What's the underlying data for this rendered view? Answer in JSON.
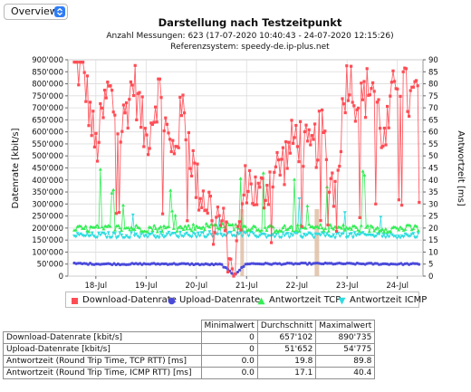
{
  "toolbar": {
    "view_select": "Overview"
  },
  "chart": {
    "title": "Darstellung nach Testzeitpunkt",
    "subtitle1": "Anzahl Messungen: 623 (17-07-2020 10:40:43 - 24-07-2020 12:15:26)",
    "subtitle2": "Referenzsystem: speedy-de.ip-plus.net",
    "ylabel_left": "Datenrate [kbit/s]",
    "ylabel_right": "Antwortzeit [ms]",
    "y_left_ticks": [
      "0",
      "50'000",
      "100'000",
      "150'000",
      "200'000",
      "250'000",
      "300'000",
      "350'000",
      "400'000",
      "450'000",
      "500'000",
      "550'000",
      "600'000",
      "650'000",
      "700'000",
      "750'000",
      "800'000",
      "850'000",
      "900'000"
    ],
    "y_right_ticks": [
      "0",
      "5",
      "10",
      "15",
      "20",
      "25",
      "30",
      "35",
      "40",
      "45",
      "50",
      "55",
      "60",
      "65",
      "70",
      "75",
      "80",
      "85",
      "90"
    ],
    "x_ticks": [
      "18-Jul",
      "19-Jul",
      "20-Jul",
      "21-Jul",
      "22-Jul",
      "23-Jul",
      "24-Jul"
    ],
    "colors": {
      "download": "#ff4d55",
      "upload": "#4b4bdb",
      "tcp": "#33ee55",
      "icmp": "#2fdde0",
      "gap": "#ddbba0"
    }
  },
  "chart_data": {
    "type": "line",
    "x_range": [
      "2020-07-17 10:40",
      "2020-07-24 12:15"
    ],
    "ylim_left": [
      0,
      900000
    ],
    "ylim_right": [
      0,
      90
    ],
    "grid": true,
    "legend_position": "bottom",
    "series": [
      {
        "name": "Download-Datenrate",
        "axis": "left",
        "x": [
          "2020-07-17 12:00",
          "2020-07-17 18:00",
          "2020-07-18 00:00",
          "2020-07-18 06:00",
          "2020-07-18 12:00",
          "2020-07-18 18:00",
          "2020-07-19 00:00",
          "2020-07-19 06:00",
          "2020-07-19 12:00",
          "2020-07-19 18:00",
          "2020-07-20 00:00",
          "2020-07-20 06:00",
          "2020-07-20 12:00",
          "2020-07-20 18:00",
          "2020-07-21 00:00",
          "2020-07-21 06:00",
          "2020-07-21 12:00",
          "2020-07-21 18:00",
          "2020-07-22 00:00",
          "2020-07-22 06:00",
          "2020-07-22 12:00",
          "2020-07-22 18:00",
          "2020-07-23 00:00",
          "2020-07-23 06:00",
          "2020-07-23 12:00",
          "2020-07-23 18:00",
          "2020-07-24 00:00",
          "2020-07-24 06:00",
          "2020-07-24 12:00"
        ],
        "values": [
          880000,
          860000,
          520000,
          780000,
          600000,
          820000,
          560000,
          780000,
          500000,
          700000,
          380000,
          300000,
          220000,
          20000,
          410000,
          320000,
          420000,
          480000,
          590000,
          500000,
          600000,
          350000,
          850000,
          700000,
          820000,
          540000,
          860000,
          720000,
          800000
        ]
      },
      {
        "name": "Upload-Datenrate",
        "axis": "left",
        "x": [
          "2020-07-17 12:00",
          "2020-07-18 12:00",
          "2020-07-19 12:00",
          "2020-07-20 12:00",
          "2020-07-20 18:00",
          "2020-07-21 00:00",
          "2020-07-21 12:00",
          "2020-07-22 12:00",
          "2020-07-23 12:00",
          "2020-07-24 12:00"
        ],
        "values": [
          52000,
          50000,
          51000,
          48000,
          5000,
          52000,
          51000,
          52000,
          51000,
          50000
        ]
      },
      {
        "name": "Antwortzeit TCP",
        "axis": "right",
        "x": [
          "2020-07-17 12:00",
          "2020-07-18 12:00",
          "2020-07-19 12:00",
          "2020-07-20 12:00",
          "2020-07-21 12:00",
          "2020-07-22 12:00",
          "2020-07-23 12:00",
          "2020-07-24 12:00"
        ],
        "values": [
          19.5,
          20.0,
          19.8,
          21.0,
          19.6,
          20.2,
          19.7,
          19.9
        ]
      },
      {
        "name": "Antwortzeit ICMP",
        "axis": "right",
        "x": [
          "2020-07-17 12:00",
          "2020-07-18 12:00",
          "2020-07-19 12:00",
          "2020-07-20 12:00",
          "2020-07-21 12:00",
          "2020-07-22 12:00",
          "2020-07-23 12:00",
          "2020-07-24 12:00"
        ],
        "values": [
          16.8,
          17.0,
          17.2,
          17.5,
          17.0,
          17.1,
          16.9,
          17.0
        ]
      }
    ]
  },
  "legend": [
    {
      "label": "Download-Datenrate",
      "color": "#ff4d55",
      "shape": "square"
    },
    {
      "label": "Upload-Datenrate",
      "color": "#4b4bdb",
      "shape": "circle"
    },
    {
      "label": "Antwortzeit TCP",
      "color": "#33ee55",
      "shape": "triangle"
    },
    {
      "label": "Antwortzeit ICMP",
      "color": "#2fdde0",
      "shape": "triangle-down"
    }
  ],
  "stats_table": {
    "headers": [
      "",
      "Minimalwert",
      "Durchschnitt",
      "Maximalwert"
    ],
    "rows": [
      [
        "Download-Datenrate [kbit/s]",
        "0",
        "657'102",
        "890'735"
      ],
      [
        "Upload-Datenrate [kbit/s]",
        "0",
        "51'652",
        "54'775"
      ],
      [
        "Antwortzeit (Round Trip Time, TCP RTT) [ms]",
        "0.0",
        "19.8",
        "89.8"
      ],
      [
        "Antwortzeit (Round Trip Time, ICMP RTT) [ms]",
        "0.0",
        "17.1",
        "40.4"
      ]
    ]
  }
}
